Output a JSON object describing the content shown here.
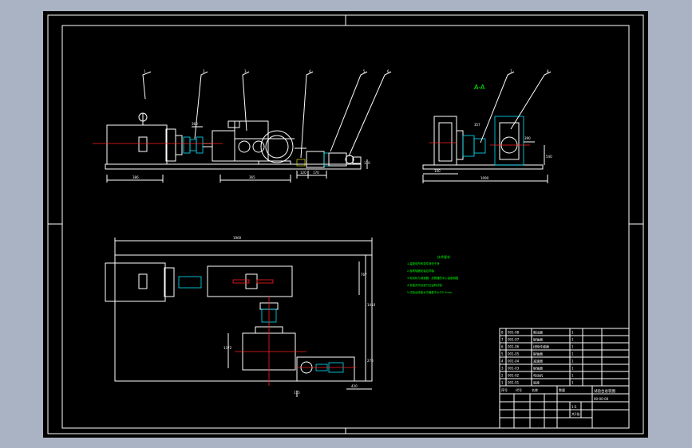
{
  "drawing": {
    "section_label": "A-A",
    "leader_numbers": [
      "1",
      "2",
      "3",
      "4",
      "5",
      "6",
      "7",
      "8"
    ],
    "dims_front": [
      "386",
      "360",
      "365",
      "120",
      "170",
      "110"
    ],
    "dims_side": [
      "100",
      "357",
      "390",
      "1090",
      "540"
    ],
    "dims_top": [
      "1960",
      "767",
      "1410",
      "420",
      "1372",
      "270",
      "115"
    ],
    "tech_title": "技术要求",
    "tech_notes": [
      "1.装配前所有零件清洗干净",
      "2.各联轴器安装应同轴",
      "3.电动机与减速器、加载器的中心高度调整",
      "4.安装完毕后进行空运转试验",
      "5.试验台底座水平偏差不大于0.1mm"
    ]
  },
  "title_block": {
    "rows": [
      {
        "code": "001-08",
        "name": "制动器",
        "qty": "1"
      },
      {
        "code": "001-07",
        "name": "联轴器",
        "qty": "1"
      },
      {
        "code": "001-06",
        "name": "扭矩传感器",
        "qty": "1"
      },
      {
        "code": "001-05",
        "name": "联轴器",
        "qty": "1"
      },
      {
        "code": "001-04",
        "name": "减速器",
        "qty": "1"
      },
      {
        "code": "001-03",
        "name": "联轴器",
        "qty": "1"
      },
      {
        "code": "001-02",
        "name": "电动机",
        "qty": "1"
      },
      {
        "code": "001-01",
        "name": "底座",
        "qty": "1"
      }
    ],
    "header": [
      "序号",
      "代号",
      "名称",
      "数量"
    ],
    "drawing_name": "试验台总装图",
    "drawing_no": "00-00-00",
    "scale": "1:5",
    "sheet": "共1张"
  }
}
